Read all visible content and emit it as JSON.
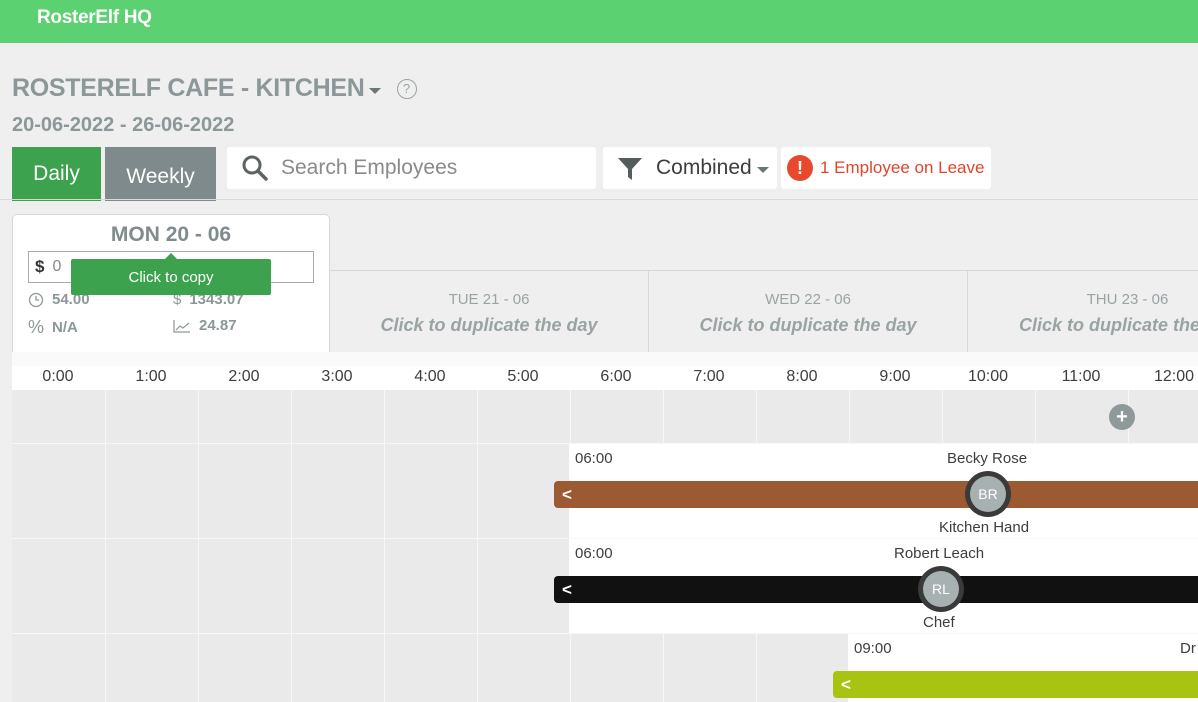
{
  "app": {
    "brand": "RosterElf HQ"
  },
  "header": {
    "location_title": "ROSTERELF CAFE - KITCHEN",
    "help_icon": "?",
    "date_range": "20-06-2022 - 26-06-2022"
  },
  "toolbar": {
    "daily_label": "Daily",
    "weekly_label": "Weekly",
    "search_placeholder": "Search Employees",
    "search_value": "",
    "filter_label": "Combined",
    "leave_label": "1 Employee on Leave",
    "leave_icon": "!"
  },
  "day_card": {
    "title": "MON 20 - 06",
    "budget_symbol": "$",
    "budget_value": "0",
    "tooltip": "Click to copy",
    "hours_value": "54.00",
    "cost_value": "1343.07",
    "percent_value": "N/A",
    "ratio_value": "24.87"
  },
  "other_days": [
    {
      "day": "TUE 21 - 06",
      "action": "Click to duplicate the day"
    },
    {
      "day": "WED 22 - 06",
      "action": "Click to duplicate the day"
    },
    {
      "day": "THU 23 - 06",
      "action": "Click to duplicate the day"
    }
  ],
  "hours": [
    "0:00",
    "1:00",
    "2:00",
    "3:00",
    "4:00",
    "5:00",
    "6:00",
    "7:00",
    "8:00",
    "9:00",
    "10:00",
    "11:00",
    "12:00"
  ],
  "shifts": [
    {
      "start": "06:00",
      "name": "Becky Rose",
      "initials": "BR",
      "role": "Kitchen Hand",
      "color": "#9b5a32"
    },
    {
      "start": "06:00",
      "name": "Robert Leach",
      "initials": "RL",
      "role": "Chef",
      "color": "#111111"
    },
    {
      "start": "09:00",
      "name": "Dr",
      "initials": "",
      "role": "",
      "color": "#a9c313"
    }
  ],
  "icons": {
    "search": "search-icon",
    "filter": "filter-icon",
    "add": "plus-icon",
    "collapse": "chevron-left-icon"
  }
}
